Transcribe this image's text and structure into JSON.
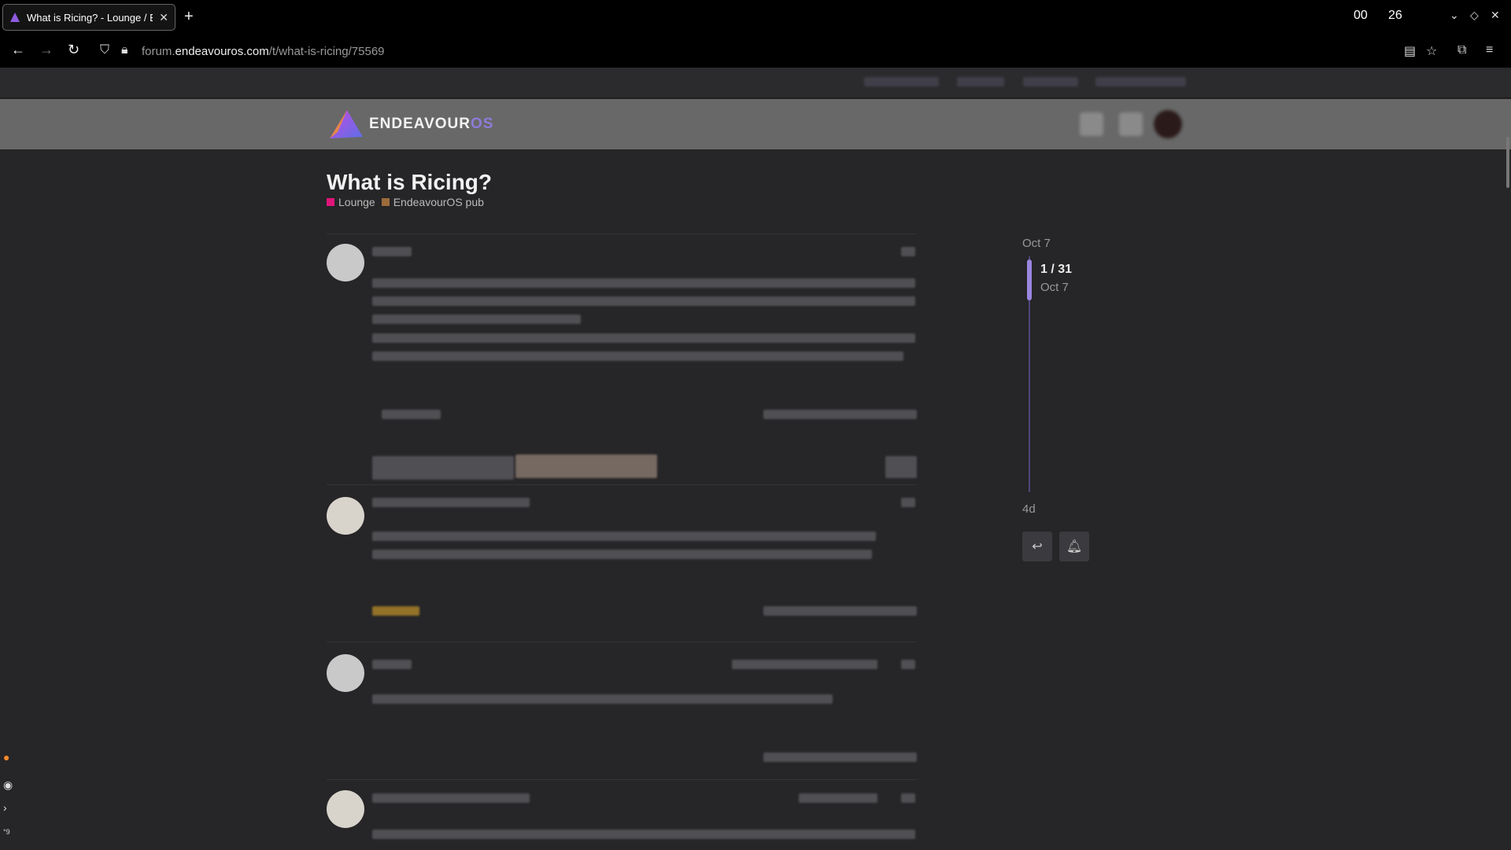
{
  "browser": {
    "tab_title": "What is Ricing? - Lounge / E",
    "new_tab_label": "+",
    "clock_hours": "00",
    "clock_minutes": "26",
    "url_prefix": "forum.",
    "url_host": "endeavouros.com",
    "url_path": "/t/what-is-ricing/75569"
  },
  "site": {
    "logo_main": "ENDEAVOUR",
    "logo_accent": "OS"
  },
  "topic": {
    "title": "What is Ricing?",
    "categories": [
      {
        "label": "Lounge",
        "color": "#e0157a"
      },
      {
        "label": "EndeavourOS pub",
        "color": "#9b6b3a"
      }
    ]
  },
  "timeline": {
    "start_date": "Oct 7",
    "position": "1 / 31",
    "position_date": "Oct 7",
    "end_date": "4d"
  },
  "colors": {
    "accent": "#8e7bd8",
    "header": "#686868",
    "background": "#262527"
  }
}
